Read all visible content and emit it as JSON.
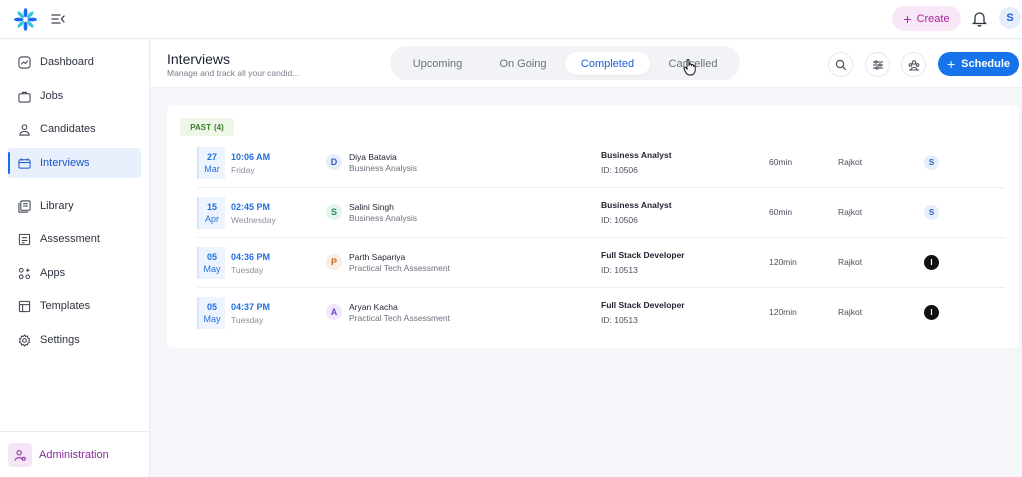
{
  "header": {
    "create_label": "Create",
    "avatar_initial": "S"
  },
  "sidebar": {
    "items": [
      {
        "label": "Dashboard",
        "icon": "dashboard-icon"
      },
      {
        "label": "Jobs",
        "icon": "briefcase-icon"
      },
      {
        "label": "Candidates",
        "icon": "user-icon"
      },
      {
        "label": "Interviews",
        "icon": "interviews-icon",
        "active": true
      },
      {
        "label": "Library",
        "icon": "library-icon"
      },
      {
        "label": "Assessment",
        "icon": "assessment-icon"
      },
      {
        "label": "Apps",
        "icon": "apps-icon"
      },
      {
        "label": "Templates",
        "icon": "templates-icon"
      },
      {
        "label": "Settings",
        "icon": "settings-icon"
      }
    ],
    "admin_label": "Administration"
  },
  "page": {
    "title": "Interviews",
    "subtitle": "Manage and track all your candid...",
    "tabs": [
      {
        "label": "Upcoming"
      },
      {
        "label": "On Going"
      },
      {
        "label": "Completed",
        "active": true
      },
      {
        "label": "Cancelled"
      }
    ],
    "schedule_label": "Schedule"
  },
  "list": {
    "group_label": "PAST",
    "group_count": "(4)",
    "rows": [
      {
        "day": "27",
        "month": "Mar",
        "time": "10:06 AM",
        "weekday": "Friday",
        "initial": "D",
        "name": "Diya Batavia",
        "assessment": "Business Analysis",
        "job_title": "Business Analyst",
        "job_id": "ID: 10506",
        "duration": "60min",
        "location": "Rajkot",
        "interviewer": "S"
      },
      {
        "day": "15",
        "month": "Apr",
        "time": "02:45 PM",
        "weekday": "Wednesday",
        "initial": "S",
        "name": "Salini Singh",
        "assessment": "Business Analysis",
        "job_title": "Business Analyst",
        "job_id": "ID: 10506",
        "duration": "60min",
        "location": "Rajkot",
        "interviewer": "S"
      },
      {
        "day": "05",
        "month": "May",
        "time": "04:36 PM",
        "weekday": "Tuesday",
        "initial": "P",
        "name": "Parth Sapariya",
        "assessment": "Practical Tech Assessment",
        "job_title": "Full Stack Developer",
        "job_id": "ID: 10513",
        "duration": "120min",
        "location": "Rajkot",
        "interviewer": "I"
      },
      {
        "day": "05",
        "month": "May",
        "time": "04:37 PM",
        "weekday": "Tuesday",
        "initial": "A",
        "name": "Aryan Kacha",
        "assessment": "Practical Tech Assessment",
        "job_title": "Full Stack Developer",
        "job_id": "ID: 10513",
        "duration": "120min",
        "location": "Rajkot",
        "interviewer": "I"
      }
    ]
  },
  "colors": {
    "primary": "#1673eb",
    "create_bg": "#f8e7f6",
    "create_text": "#b0259f",
    "admin_text": "#8b2a9c",
    "past_badge_bg": "#eef6e8",
    "past_badge_text": "#3e7d2d"
  }
}
